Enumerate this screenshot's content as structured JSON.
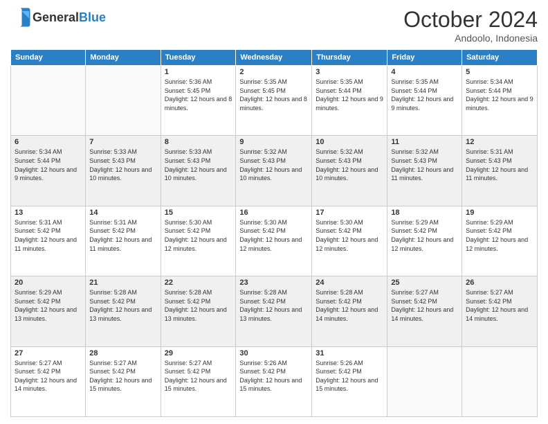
{
  "header": {
    "logo_general": "General",
    "logo_blue": "Blue",
    "month_title": "October 2024",
    "location": "Andoolo, Indonesia"
  },
  "days_of_week": [
    "Sunday",
    "Monday",
    "Tuesday",
    "Wednesday",
    "Thursday",
    "Friday",
    "Saturday"
  ],
  "weeks": [
    [
      {
        "day": "",
        "info": ""
      },
      {
        "day": "",
        "info": ""
      },
      {
        "day": "1",
        "info": "Sunrise: 5:36 AM\nSunset: 5:45 PM\nDaylight: 12 hours and 8 minutes."
      },
      {
        "day": "2",
        "info": "Sunrise: 5:35 AM\nSunset: 5:45 PM\nDaylight: 12 hours and 8 minutes."
      },
      {
        "day": "3",
        "info": "Sunrise: 5:35 AM\nSunset: 5:44 PM\nDaylight: 12 hours and 9 minutes."
      },
      {
        "day": "4",
        "info": "Sunrise: 5:35 AM\nSunset: 5:44 PM\nDaylight: 12 hours and 9 minutes."
      },
      {
        "day": "5",
        "info": "Sunrise: 5:34 AM\nSunset: 5:44 PM\nDaylight: 12 hours and 9 minutes."
      }
    ],
    [
      {
        "day": "6",
        "info": "Sunrise: 5:34 AM\nSunset: 5:44 PM\nDaylight: 12 hours and 9 minutes."
      },
      {
        "day": "7",
        "info": "Sunrise: 5:33 AM\nSunset: 5:43 PM\nDaylight: 12 hours and 10 minutes."
      },
      {
        "day": "8",
        "info": "Sunrise: 5:33 AM\nSunset: 5:43 PM\nDaylight: 12 hours and 10 minutes."
      },
      {
        "day": "9",
        "info": "Sunrise: 5:32 AM\nSunset: 5:43 PM\nDaylight: 12 hours and 10 minutes."
      },
      {
        "day": "10",
        "info": "Sunrise: 5:32 AM\nSunset: 5:43 PM\nDaylight: 12 hours and 10 minutes."
      },
      {
        "day": "11",
        "info": "Sunrise: 5:32 AM\nSunset: 5:43 PM\nDaylight: 12 hours and 11 minutes."
      },
      {
        "day": "12",
        "info": "Sunrise: 5:31 AM\nSunset: 5:43 PM\nDaylight: 12 hours and 11 minutes."
      }
    ],
    [
      {
        "day": "13",
        "info": "Sunrise: 5:31 AM\nSunset: 5:42 PM\nDaylight: 12 hours and 11 minutes."
      },
      {
        "day": "14",
        "info": "Sunrise: 5:31 AM\nSunset: 5:42 PM\nDaylight: 12 hours and 11 minutes."
      },
      {
        "day": "15",
        "info": "Sunrise: 5:30 AM\nSunset: 5:42 PM\nDaylight: 12 hours and 12 minutes."
      },
      {
        "day": "16",
        "info": "Sunrise: 5:30 AM\nSunset: 5:42 PM\nDaylight: 12 hours and 12 minutes."
      },
      {
        "day": "17",
        "info": "Sunrise: 5:30 AM\nSunset: 5:42 PM\nDaylight: 12 hours and 12 minutes."
      },
      {
        "day": "18",
        "info": "Sunrise: 5:29 AM\nSunset: 5:42 PM\nDaylight: 12 hours and 12 minutes."
      },
      {
        "day": "19",
        "info": "Sunrise: 5:29 AM\nSunset: 5:42 PM\nDaylight: 12 hours and 12 minutes."
      }
    ],
    [
      {
        "day": "20",
        "info": "Sunrise: 5:29 AM\nSunset: 5:42 PM\nDaylight: 12 hours and 13 minutes."
      },
      {
        "day": "21",
        "info": "Sunrise: 5:28 AM\nSunset: 5:42 PM\nDaylight: 12 hours and 13 minutes."
      },
      {
        "day": "22",
        "info": "Sunrise: 5:28 AM\nSunset: 5:42 PM\nDaylight: 12 hours and 13 minutes."
      },
      {
        "day": "23",
        "info": "Sunrise: 5:28 AM\nSunset: 5:42 PM\nDaylight: 12 hours and 13 minutes."
      },
      {
        "day": "24",
        "info": "Sunrise: 5:28 AM\nSunset: 5:42 PM\nDaylight: 12 hours and 14 minutes."
      },
      {
        "day": "25",
        "info": "Sunrise: 5:27 AM\nSunset: 5:42 PM\nDaylight: 12 hours and 14 minutes."
      },
      {
        "day": "26",
        "info": "Sunrise: 5:27 AM\nSunset: 5:42 PM\nDaylight: 12 hours and 14 minutes."
      }
    ],
    [
      {
        "day": "27",
        "info": "Sunrise: 5:27 AM\nSunset: 5:42 PM\nDaylight: 12 hours and 14 minutes."
      },
      {
        "day": "28",
        "info": "Sunrise: 5:27 AM\nSunset: 5:42 PM\nDaylight: 12 hours and 15 minutes."
      },
      {
        "day": "29",
        "info": "Sunrise: 5:27 AM\nSunset: 5:42 PM\nDaylight: 12 hours and 15 minutes."
      },
      {
        "day": "30",
        "info": "Sunrise: 5:26 AM\nSunset: 5:42 PM\nDaylight: 12 hours and 15 minutes."
      },
      {
        "day": "31",
        "info": "Sunrise: 5:26 AM\nSunset: 5:42 PM\nDaylight: 12 hours and 15 minutes."
      },
      {
        "day": "",
        "info": ""
      },
      {
        "day": "",
        "info": ""
      }
    ]
  ]
}
